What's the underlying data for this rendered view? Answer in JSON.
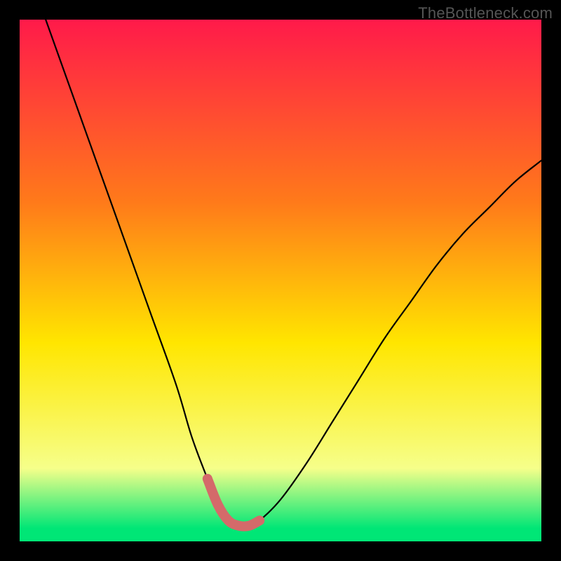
{
  "watermark": "TheBottleneck.com",
  "colors": {
    "bg": "#000000",
    "grad_top": "#ff1a4a",
    "grad_mid1": "#ff7a1a",
    "grad_mid2": "#ffe600",
    "grad_low": "#f6ff8a",
    "grad_bottom": "#00e676",
    "curve": "#000000",
    "marker": "#d46a6a"
  },
  "chart_data": {
    "type": "line",
    "title": "",
    "xlabel": "",
    "ylabel": "",
    "xlim": [
      0,
      100
    ],
    "ylim": [
      0,
      100
    ],
    "series": [
      {
        "name": "bottleneck-curve",
        "x": [
          5,
          10,
          15,
          20,
          25,
          30,
          33,
          36,
          38,
          40,
          42,
          44,
          46,
          50,
          55,
          60,
          65,
          70,
          75,
          80,
          85,
          90,
          95,
          100
        ],
        "y": [
          100,
          86,
          72,
          58,
          44,
          30,
          20,
          12,
          7,
          4,
          3,
          3,
          4,
          8,
          15,
          23,
          31,
          39,
          46,
          53,
          59,
          64,
          69,
          73
        ]
      }
    ],
    "highlight": {
      "name": "valley-marker",
      "x_range": [
        36,
        48
      ],
      "y_approx": 3
    },
    "gradient_stops": [
      {
        "offset": 0.0,
        "key": "grad_top"
      },
      {
        "offset": 0.35,
        "key": "grad_mid1"
      },
      {
        "offset": 0.62,
        "key": "grad_mid2"
      },
      {
        "offset": 0.86,
        "key": "grad_low"
      },
      {
        "offset": 0.975,
        "key": "grad_bottom"
      }
    ]
  }
}
